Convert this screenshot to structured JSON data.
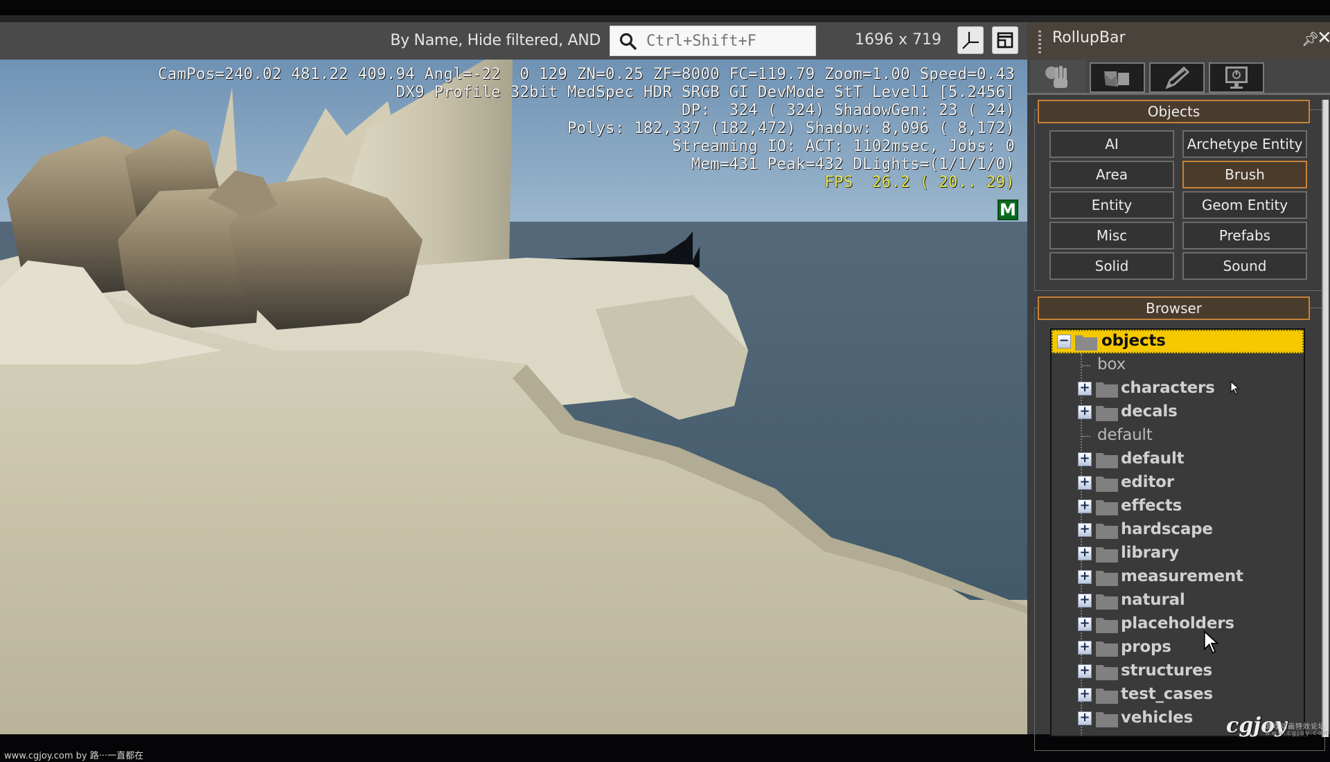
{
  "toolbar": {
    "filter_label": "By Name, Hide filtered, AND",
    "search_placeholder": "Ctrl+Shift+F",
    "search_value": "",
    "resolution": "1696 x 719",
    "axis_button_icon": "axis-gizmo-icon",
    "maximize_button_icon": "maximize-viewport-icon"
  },
  "hud": {
    "lines": [
      "CamPos=240.02 481.22 409.94 Angl=-22  0 129 ZN=0.25 ZF=8000 FC=119.79 Zoom=1.00 Speed=0.43",
      "DX9 Profile 32bit MedSpec HDR SRGB GI DevMode StT Level1 [5.2456]",
      "DP:  324 ( 324) ShadowGen: 23 ( 24)",
      "Polys: 182,337 (182,472) Shadow: 8,096 ( 8,172)",
      "Streaming IO: ACT: 1102msec, Jobs: 0",
      "Mem=431 Peak=432 DLights=(1/1/1/0)"
    ],
    "fps_line": "FPS  26.2 ( 20.. 29)",
    "mode_badge": "M",
    "fps_color": "#e8e84a",
    "badge_color": "#0a6b1f"
  },
  "rollup": {
    "title": "RollupBar",
    "pin_icon": "pin-icon",
    "close_icon": "close-icon",
    "tabs": [
      {
        "name": "objects-tab",
        "icon": "hand-icon",
        "active": true
      },
      {
        "name": "terrain-tab",
        "icon": "terrain-icon",
        "active": false
      },
      {
        "name": "modify-tab",
        "icon": "pencil-icon",
        "active": false
      },
      {
        "name": "display-tab",
        "icon": "monitor-power-icon",
        "active": false
      }
    ],
    "objects_header": "Objects",
    "object_buttons": [
      {
        "label": "AI",
        "selected": false
      },
      {
        "label": "Archetype Entity",
        "selected": false
      },
      {
        "label": "Area",
        "selected": false
      },
      {
        "label": "Brush",
        "selected": true
      },
      {
        "label": "Entity",
        "selected": false
      },
      {
        "label": "Geom Entity",
        "selected": false
      },
      {
        "label": "Misc",
        "selected": false
      },
      {
        "label": "Prefabs",
        "selected": false
      },
      {
        "label": "Solid",
        "selected": false
      },
      {
        "label": "Sound",
        "selected": false
      }
    ],
    "browser_header": "Browser",
    "tree": {
      "root": {
        "label": "objects",
        "expanded": true,
        "selected": true
      },
      "children": [
        {
          "label": "box",
          "type": "leaf"
        },
        {
          "label": "characters",
          "type": "folder"
        },
        {
          "label": "decals",
          "type": "folder"
        },
        {
          "label": "default",
          "type": "leaf"
        },
        {
          "label": "default",
          "type": "folder"
        },
        {
          "label": "editor",
          "type": "folder"
        },
        {
          "label": "effects",
          "type": "folder"
        },
        {
          "label": "hardscape",
          "type": "folder"
        },
        {
          "label": "library",
          "type": "folder"
        },
        {
          "label": "measurement",
          "type": "folder"
        },
        {
          "label": "natural",
          "type": "folder"
        },
        {
          "label": "placeholders",
          "type": "folder"
        },
        {
          "label": "props",
          "type": "folder"
        },
        {
          "label": "structures",
          "type": "folder"
        },
        {
          "label": "test_cases",
          "type": "folder"
        },
        {
          "label": "vehicles",
          "type": "folder"
        }
      ]
    },
    "accent_color": "#c8823a",
    "selection_color": "#f5c800"
  },
  "watermark": {
    "credit": "www.cgjoy.com by 路···一直都在",
    "logo": "cgjoy",
    "logo_sub": "游戏动画特效论坛",
    "logo_url": "www.cgjoy.com"
  }
}
